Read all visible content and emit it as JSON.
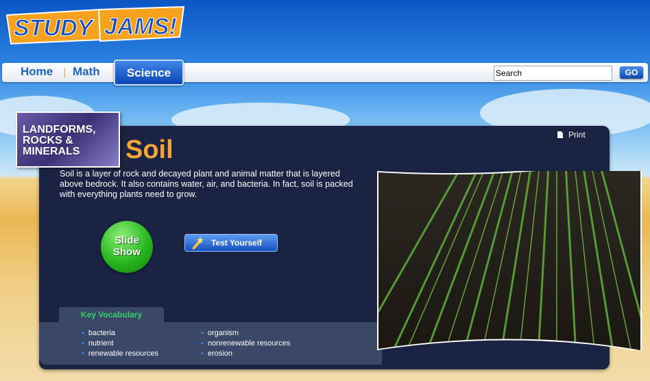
{
  "logo": {
    "left": "STUDY",
    "right": "JAMS!"
  },
  "nav": {
    "home": "Home",
    "math": "Math",
    "science": "Science",
    "search_value": "Search",
    "go": "GO"
  },
  "badge": {
    "line1": "LANDFORMS,",
    "line2": "ROCKS &",
    "line3": "MINERALS"
  },
  "lesson": {
    "title": "Soil",
    "print": "Print",
    "intro": "Soil is a layer of rock and decayed plant and animal matter that is layered above bedrock. It also contains water, air, and bacteria. In fact, soil is packed with everything plants need to grow."
  },
  "buttons": {
    "slide_line1": "Slide",
    "slide_line2": "Show",
    "test_yourself": "Test Yourself"
  },
  "vocabulary": {
    "heading": "Key Vocabulary",
    "col1": [
      "bacteria",
      "nutrient",
      "renewable resources"
    ],
    "col2": [
      "organism",
      "nonrenewable resources",
      "erosion"
    ]
  },
  "colors": {
    "accent": "#f3a53a",
    "nav_blue": "#1a64c4",
    "panel": "#1b2343",
    "vocab_green": "#2fd06a"
  }
}
